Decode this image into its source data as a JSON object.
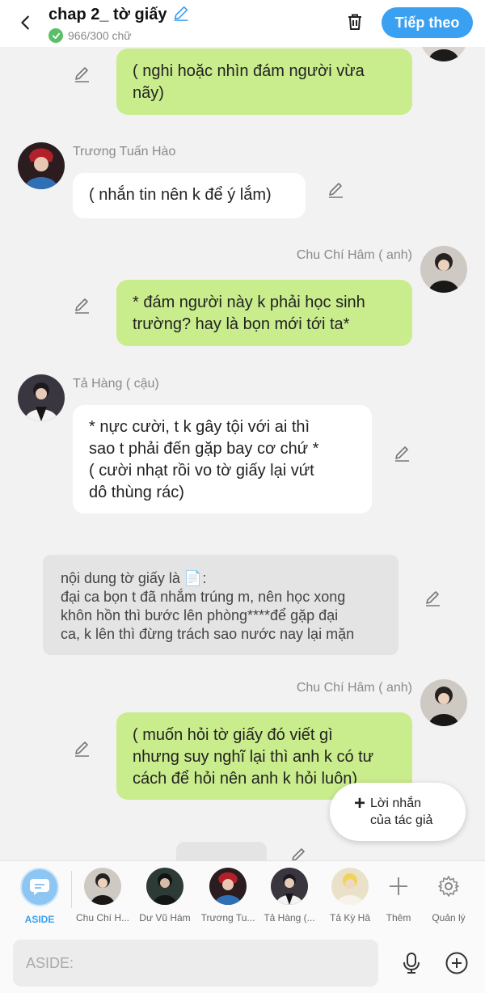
{
  "header": {
    "title": "chap 2_ tờ giấy",
    "word_count": "966/300 chữ",
    "next_label": "Tiếp theo",
    "accent_color": "#3aa0f2"
  },
  "messages": [
    {
      "type": "right",
      "text": "( nghi hoặc nhìn đám người vừa\nnãy)"
    },
    {
      "type": "left",
      "sender": "Trương Tuấn Hào",
      "text": "( nhắn tin nên k để ý lắm)"
    },
    {
      "type": "right",
      "sender": "Chu Chí Hâm ( anh)",
      "text": "* đám người này k phải học sinh\ntrường? hay là bọn mới tới ta*"
    },
    {
      "type": "left",
      "sender": "Tả Hàng ( cậu)",
      "text": "* nực cười, t k gây tội với ai thì\nsao t phải đến gặp bay cơ chứ *\n( cười nhạt rồi vo tờ giấy lại vứt\ndô thùng rác)"
    },
    {
      "type": "aside",
      "text": "nội dung tờ giấy là 📄:\nđại ca bọn t đã nhắm trúng m, nên học xong\nkhôn hồn thì bước lên phòng****để gặp đại\nca, k lên thì đừng trách sao nước nay lại mặn"
    },
    {
      "type": "right",
      "sender": "Chu Chí Hâm ( anh)",
      "text": "( muốn hỏi tờ giấy đó viết gì\nnhưng suy nghĩ lại thì anh k có tư\ncách để hỏi nên anh k hỏi luôn)"
    }
  ],
  "author_note": {
    "label": "Lời nhắn\ncủa tác giả"
  },
  "characters": [
    {
      "label": "ASIDE"
    },
    {
      "label": "Chu Chí H..."
    },
    {
      "label": "Dư Vũ Hàm"
    },
    {
      "label": "Trương Tu..."
    },
    {
      "label": "Tả Hàng (..."
    },
    {
      "label": "Tả Kỳ Hâ"
    }
  ],
  "more_label": "Thêm",
  "manage_label": "Quản lý",
  "input": {
    "placeholder": "ASIDE:"
  }
}
